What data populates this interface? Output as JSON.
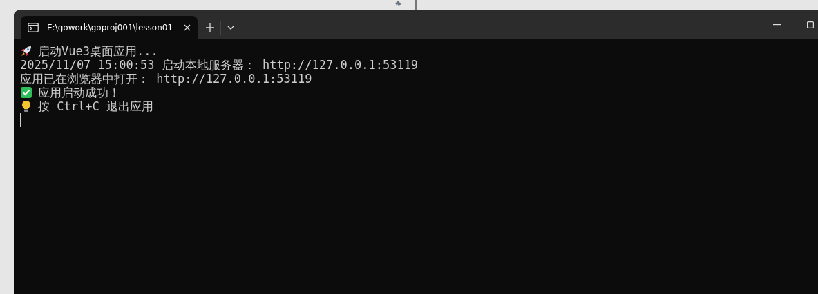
{
  "tab": {
    "title": "E:\\gowork\\goproj001\\lesson01",
    "selected": true
  },
  "lines": [
    {
      "kind": "rocket",
      "text": "启动Vue3桌面应用..."
    },
    {
      "kind": "plain",
      "text": "2025/11/07 15:00:53 启动本地服务器： http://127.0.0.1:53119"
    },
    {
      "kind": "plain",
      "text": "应用已在浏览器中打开： http://127.0.0.1:53119"
    },
    {
      "kind": "check",
      "text": "应用启动成功！"
    },
    {
      "kind": "bulb",
      "text": "按 Ctrl+C 退出应用"
    }
  ]
}
